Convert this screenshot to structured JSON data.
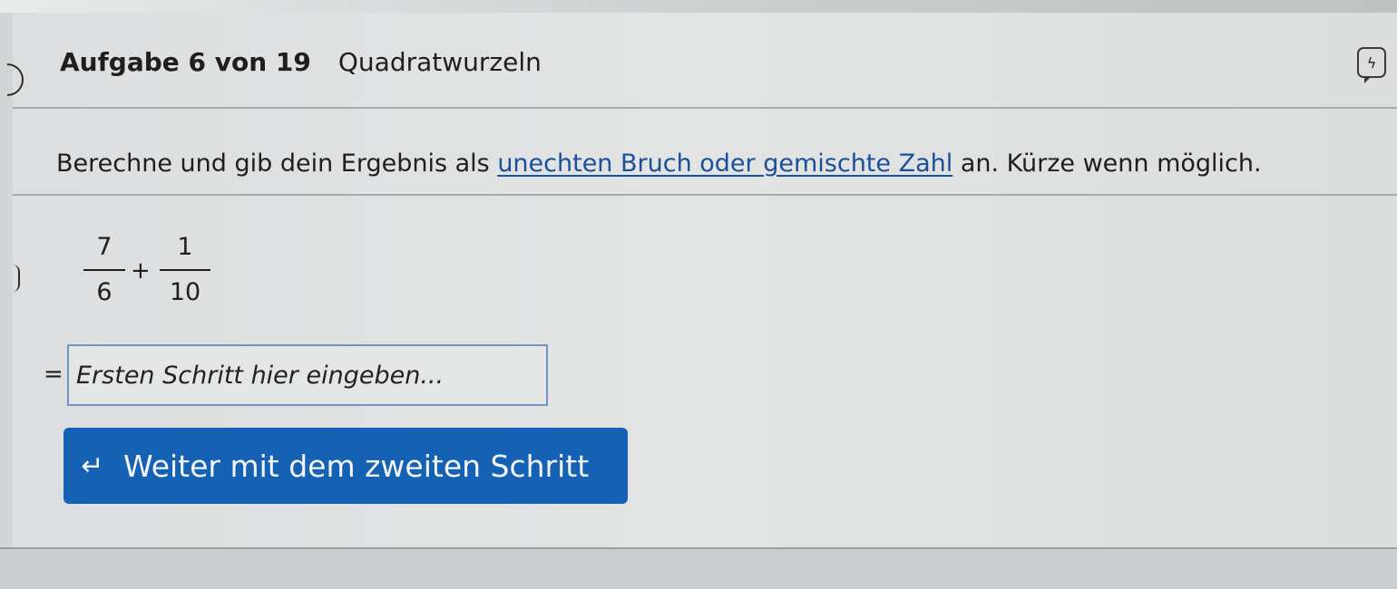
{
  "header": {
    "task_counter": "Aufgabe 6 von 19",
    "topic": "Quadratwurzeln",
    "badge_icon": "lightning-bolt-icon",
    "badge_glyph": "ϟ"
  },
  "instruction": {
    "text_before": "Berechne und gib dein Ergebnis als ",
    "link_text": "unechten Bruch oder gemischte Zahl",
    "text_after": " an. Kürze wenn möglich."
  },
  "expression": {
    "fraction1": {
      "numerator": "7",
      "denominator": "6"
    },
    "operator": "+",
    "fraction2": {
      "numerator": "1",
      "denominator": "10"
    }
  },
  "answer": {
    "equals_sign": "=",
    "placeholder": "Ersten Schritt hier eingeben...",
    "value": ""
  },
  "next_button": {
    "icon": "return-arrow-icon",
    "icon_glyph": "↵",
    "label": "Weiter mit dem zweiten Schritt"
  },
  "colors": {
    "accent": "#1561b4",
    "link": "#1a4f9a",
    "input_border": "#7793bd"
  }
}
